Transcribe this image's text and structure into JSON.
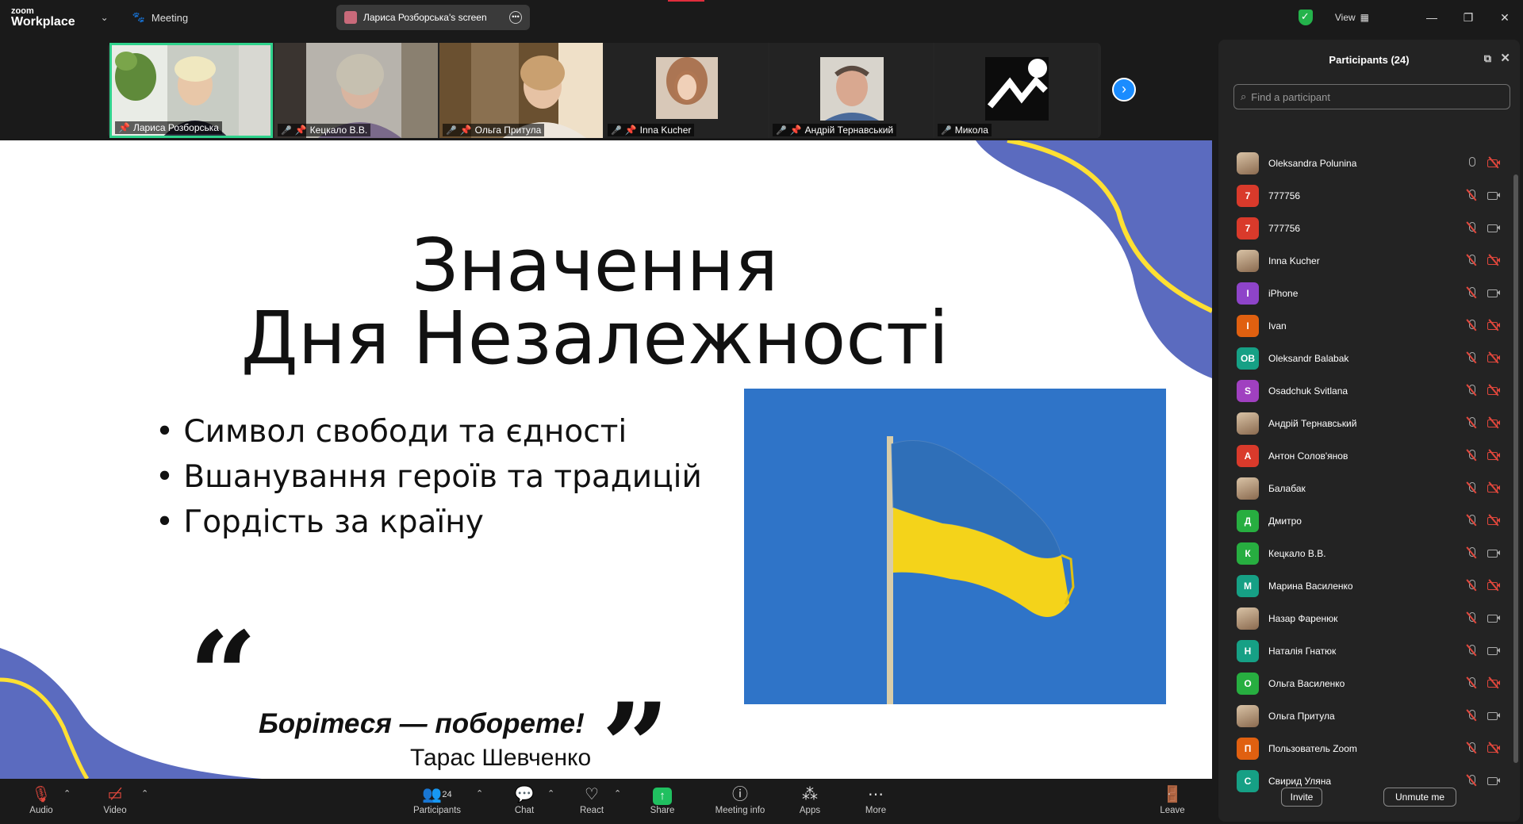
{
  "titlebar": {
    "logo_top": "zoom",
    "logo_bottom": "Workplace",
    "meeting_label": "Meeting",
    "screen_tab_label": "Лариса Розборська's screen",
    "view_label": "View"
  },
  "video_strip": {
    "tiles": [
      {
        "name": "Лариса Розборська"
      },
      {
        "name": "Кецкало В.В."
      },
      {
        "name": "Ольга Притула"
      },
      {
        "name": "Inna Kucher"
      },
      {
        "name": "Андрій Тернавський"
      },
      {
        "name": "Микола"
      }
    ]
  },
  "slide": {
    "title_line1": "Значення",
    "title_line2": "Дня Незалежності",
    "bullets": [
      "Символ свободи та єдності",
      "Вшанування героїв та традицій",
      "Гордість за країну"
    ],
    "quote": "Борітеся — поборете!",
    "quote_author": "Тарас Шевченко",
    "colors": {
      "blue": "#5b6bbf",
      "yellow": "#ffe033",
      "sky": "#2f74c8",
      "flag_blue": "#2f6fb8",
      "flag_yellow": "#f4d31a"
    }
  },
  "participants_panel": {
    "title": "Participants (24)",
    "search_placeholder": "Find a participant",
    "participants": [
      {
        "name": "Oleksandra Polunina",
        "initial": "",
        "color": "#b89060",
        "photo": true,
        "mic_muted": false,
        "video_off": true
      },
      {
        "name": "777756",
        "initial": "7",
        "color": "#d93a2b",
        "photo": false,
        "mic_muted": true,
        "video_off": false
      },
      {
        "name": "777756",
        "initial": "7",
        "color": "#d93a2b",
        "photo": false,
        "mic_muted": true,
        "video_off": false
      },
      {
        "name": "Inna Kucher",
        "initial": "",
        "color": "#a07050",
        "photo": true,
        "mic_muted": true,
        "video_off": true
      },
      {
        "name": "iPhone",
        "initial": "I",
        "color": "#8e44c9",
        "photo": false,
        "mic_muted": true,
        "video_off": false
      },
      {
        "name": "Ivan",
        "initial": "I",
        "color": "#e06010",
        "photo": false,
        "mic_muted": true,
        "video_off": true
      },
      {
        "name": "Oleksandr Balabak",
        "initial": "OB",
        "color": "#16a085",
        "photo": false,
        "mic_muted": true,
        "video_off": true
      },
      {
        "name": "Osadchuk Svitlana",
        "initial": "S",
        "color": "#a040c0",
        "photo": false,
        "mic_muted": true,
        "video_off": true
      },
      {
        "name": "Андрій Тернавський",
        "initial": "",
        "color": "#c0a090",
        "photo": true,
        "mic_muted": true,
        "video_off": true
      },
      {
        "name": "Антон Солов'янов",
        "initial": "А",
        "color": "#d93a2b",
        "photo": false,
        "mic_muted": true,
        "video_off": true
      },
      {
        "name": "Балабак",
        "initial": "",
        "color": "#8aa070",
        "photo": true,
        "mic_muted": true,
        "video_off": true
      },
      {
        "name": "Дмитро",
        "initial": "Д",
        "color": "#27ae40",
        "photo": false,
        "mic_muted": true,
        "video_off": true
      },
      {
        "name": "Кецкало В.В.",
        "initial": "К",
        "color": "#27ae40",
        "photo": false,
        "mic_muted": true,
        "video_off": false
      },
      {
        "name": "Марина Василенко",
        "initial": "М",
        "color": "#16a085",
        "photo": false,
        "mic_muted": true,
        "video_off": true
      },
      {
        "name": "Назар Фаренюк",
        "initial": "",
        "color": "#6a7a90",
        "photo": true,
        "mic_muted": true,
        "video_off": false
      },
      {
        "name": "Наталія Гнатюк",
        "initial": "Н",
        "color": "#16a085",
        "photo": false,
        "mic_muted": true,
        "video_off": false
      },
      {
        "name": "Ольга Василенко",
        "initial": "О",
        "color": "#27ae40",
        "photo": false,
        "mic_muted": true,
        "video_off": true
      },
      {
        "name": "Ольга Притула",
        "initial": "",
        "color": "#d0a080",
        "photo": true,
        "mic_muted": true,
        "video_off": false
      },
      {
        "name": "Пользователь Zoom",
        "initial": "П",
        "color": "#e06010",
        "photo": false,
        "mic_muted": true,
        "video_off": true
      },
      {
        "name": "Свирид Уляна",
        "initial": "С",
        "color": "#16a085",
        "photo": false,
        "mic_muted": true,
        "video_off": false
      }
    ],
    "invite_label": "Invite",
    "unmute_label": "Unmute me"
  },
  "toolbar": {
    "audio": "Audio",
    "video": "Video",
    "participants": "Participants",
    "participants_count": "24",
    "chat": "Chat",
    "react": "React",
    "share": "Share",
    "meeting_info": "Meeting info",
    "apps": "Apps",
    "more": "More",
    "leave": "Leave"
  }
}
